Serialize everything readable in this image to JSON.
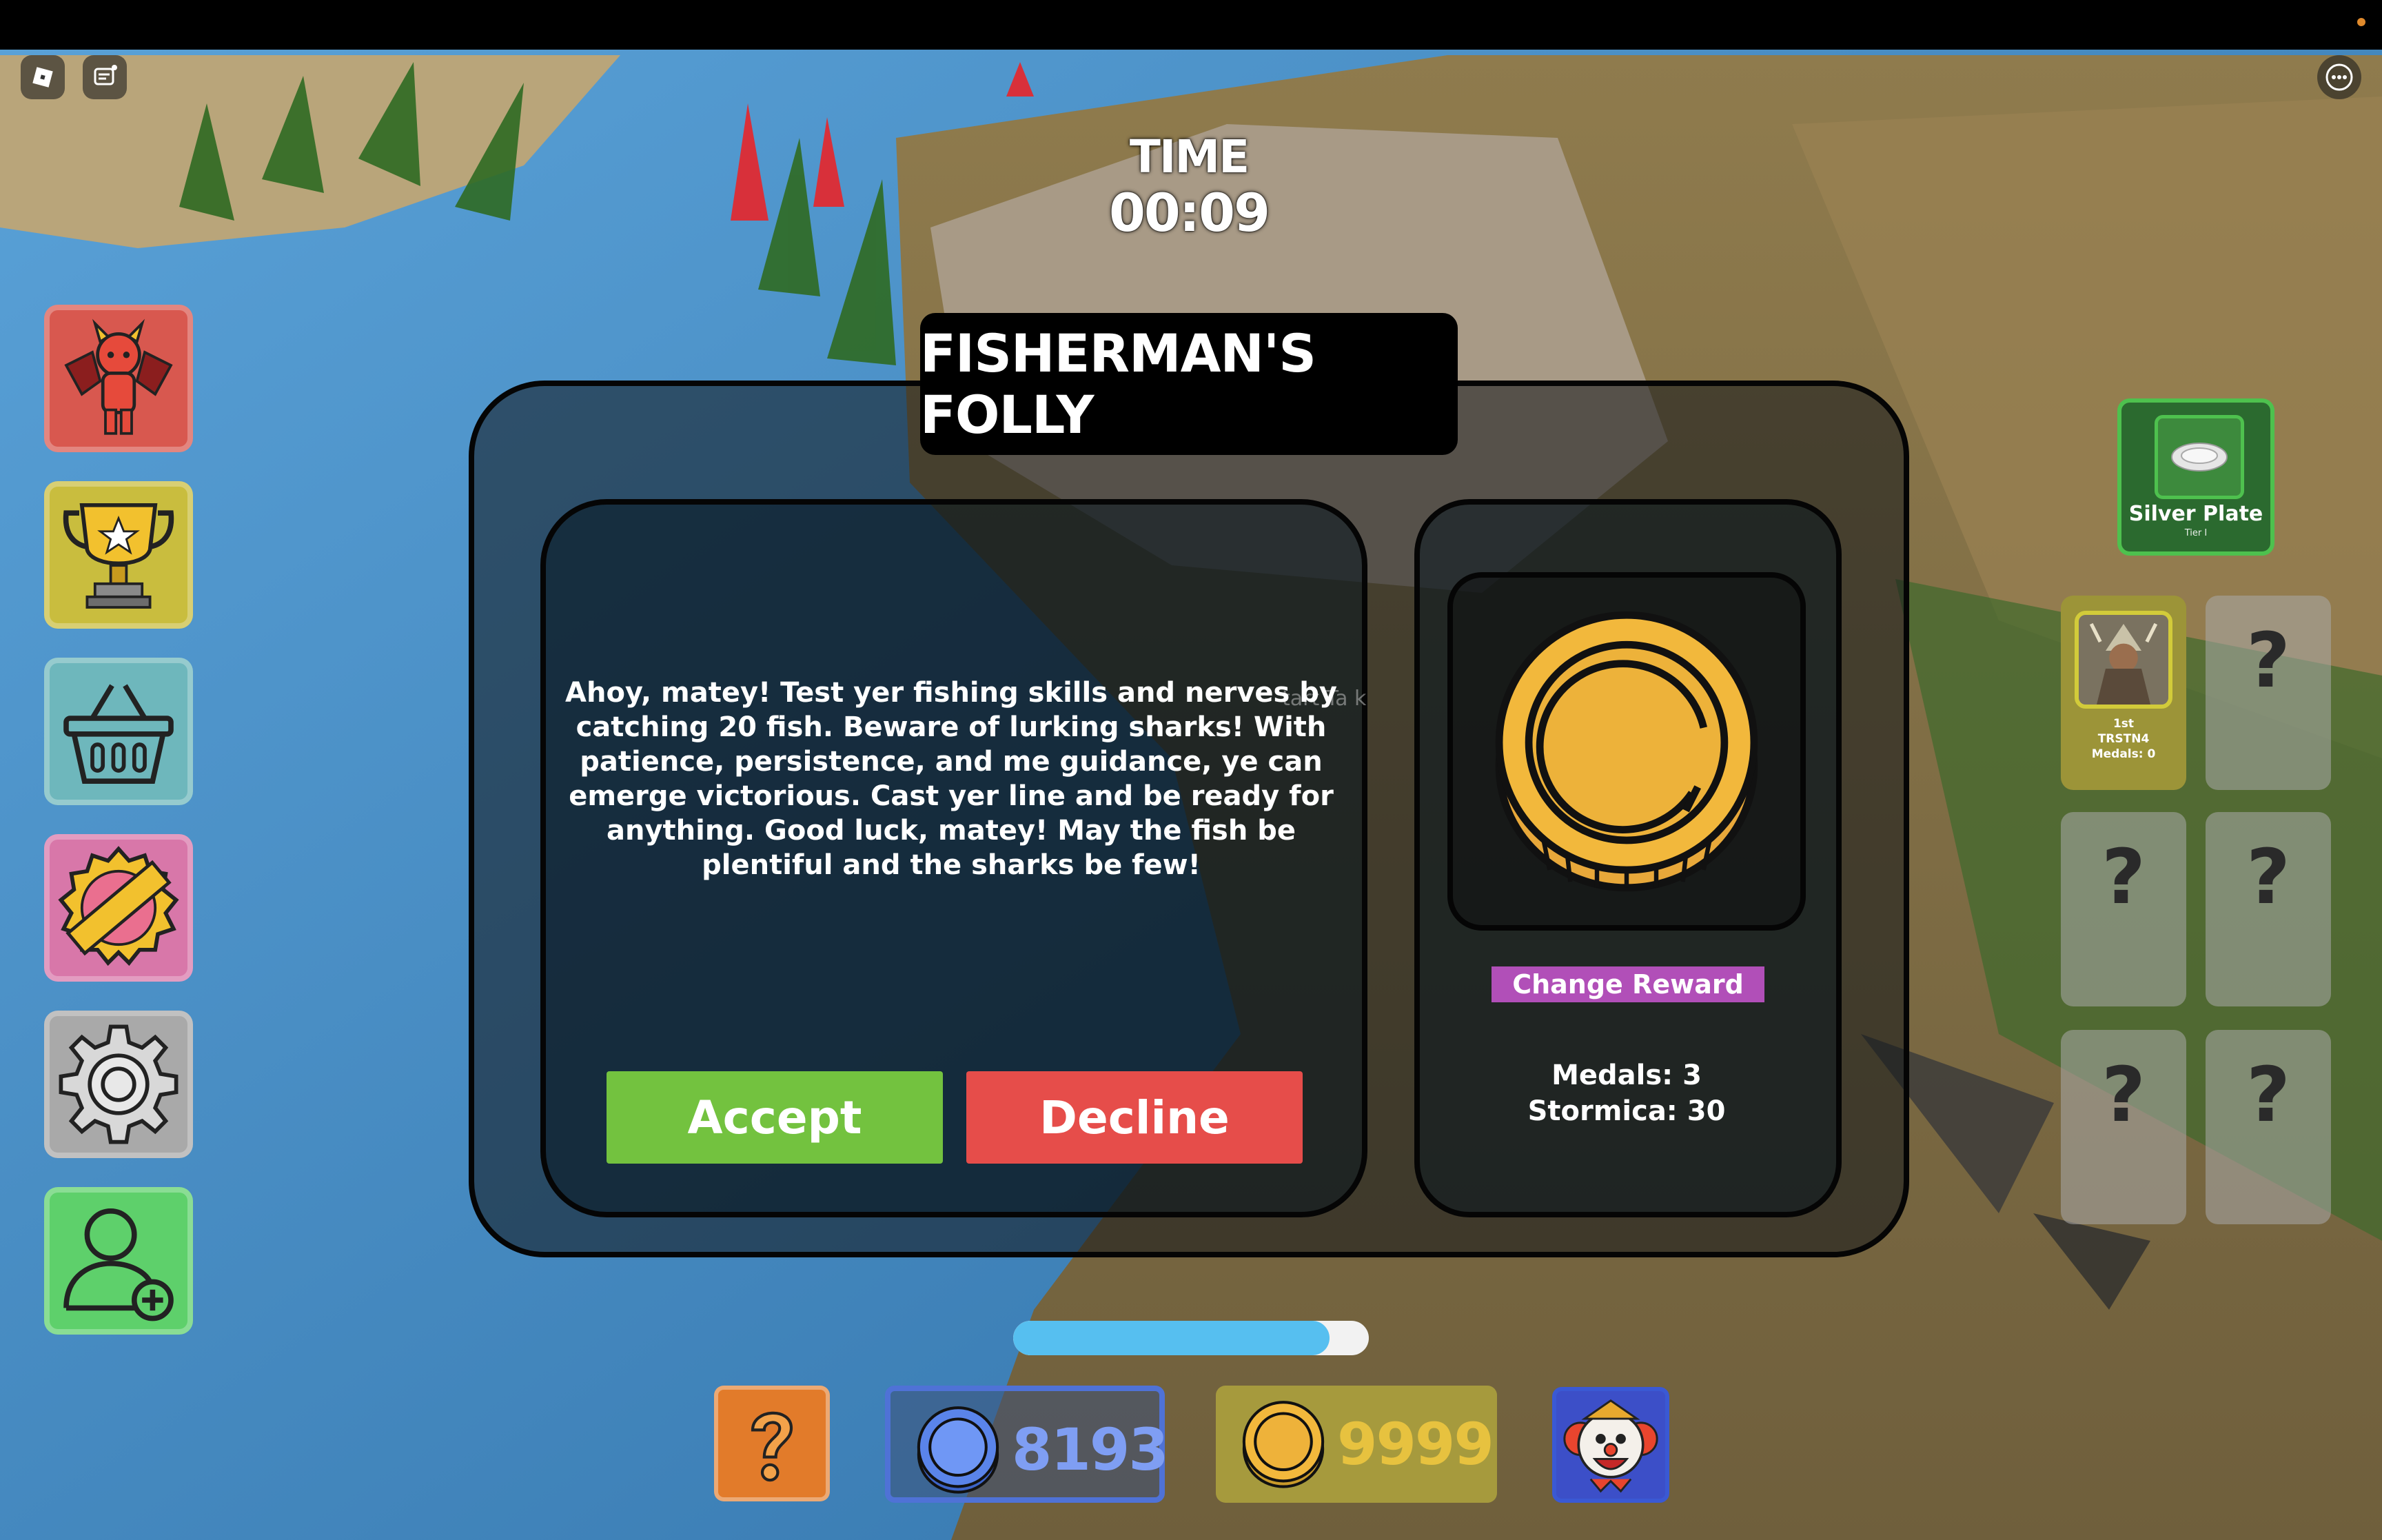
{
  "timer": {
    "label": "TIME",
    "value": "00:09"
  },
  "dialog": {
    "title": "FISHERMAN'S FOLLY",
    "description": "Ahoy, matey! Test yer fishing skills and nerves by catching 20 fish. Beware of lurking sharks! With patience, persistence, and me guidance, ye can emerge victorious. Cast yer line and be ready for anything. Good luck, matey! May the fish be plentiful and the sharks be few!",
    "ghost_text": "tart Ta k",
    "accept_label": "Accept",
    "decline_label": "Decline",
    "reward": {
      "icon": "gold-coin-icon",
      "change_label": "Change Reward",
      "medals": "Medals: 3",
      "stormica": "Stormica: 30"
    }
  },
  "left_menu": [
    {
      "name": "demon-menu-button",
      "icon": "devil-icon"
    },
    {
      "name": "trophy-menu-button",
      "icon": "trophy-icon"
    },
    {
      "name": "shop-menu-button",
      "icon": "basket-icon"
    },
    {
      "name": "exclusive-menu-button",
      "icon": "exclusive-badge-icon"
    },
    {
      "name": "settings-menu-button",
      "icon": "gear-icon"
    },
    {
      "name": "invite-friend-button",
      "icon": "add-user-icon"
    }
  ],
  "silver_plate": {
    "name": "Silver Plate",
    "tier": "Tier I"
  },
  "medal_slots": {
    "first": {
      "rank": "1st",
      "player": "TRSTN4",
      "medals": "Medals: 0"
    },
    "unknown_mark": "?"
  },
  "progress": {
    "fraction": 0.89
  },
  "hud": {
    "blue_coins": "8193",
    "gold_coins": "9999"
  },
  "colors": {
    "accept": "#73c23f",
    "decline": "#e64d4a",
    "change_reward": "#b14fb8",
    "progress_fill": "#56bff0"
  }
}
